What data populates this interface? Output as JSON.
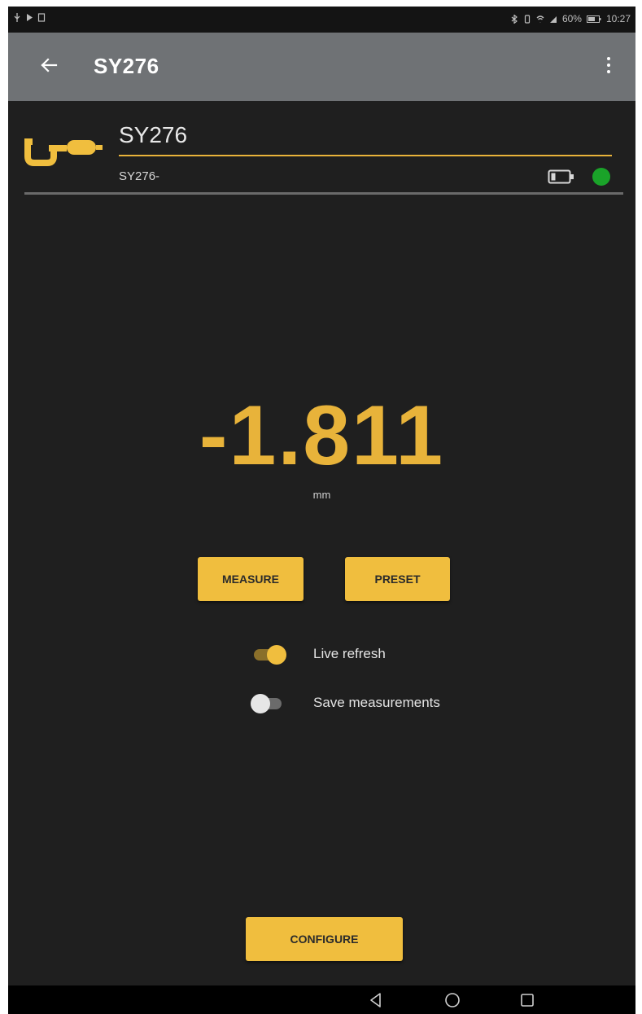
{
  "status_bar": {
    "icons_left": [
      "usb-icon",
      "play-icon",
      "sim-icon"
    ],
    "icons_right": [
      "bluetooth-icon",
      "vibrate-icon",
      "wifi-icon",
      "signal-icon",
      "battery-icon"
    ],
    "battery": "60%",
    "time": "10:27"
  },
  "app_bar": {
    "title": "SY276",
    "back_icon": "arrow-back-icon",
    "menu_icon": "more-vert-icon"
  },
  "device": {
    "name": "SY276",
    "subtitle": "SY276-",
    "icon": "micrometer-icon",
    "battery_icon": "battery-low-icon",
    "connection_status_color": "#1aa329"
  },
  "measurement": {
    "value": "-1.811",
    "unit": "mm"
  },
  "buttons": {
    "measure": "MEASURE",
    "preset": "PRESET",
    "configure": "CONFIGURE"
  },
  "toggles": [
    {
      "label": "Live refresh",
      "on": true
    },
    {
      "label": "Save measurements",
      "on": false
    }
  ],
  "colors": {
    "accent": "#f0be3e",
    "app_bar": "#6f7275",
    "background": "#1f1f1f"
  },
  "nav_bar": {
    "icons": [
      "nav-back-icon",
      "nav-home-icon",
      "nav-recents-icon"
    ]
  }
}
